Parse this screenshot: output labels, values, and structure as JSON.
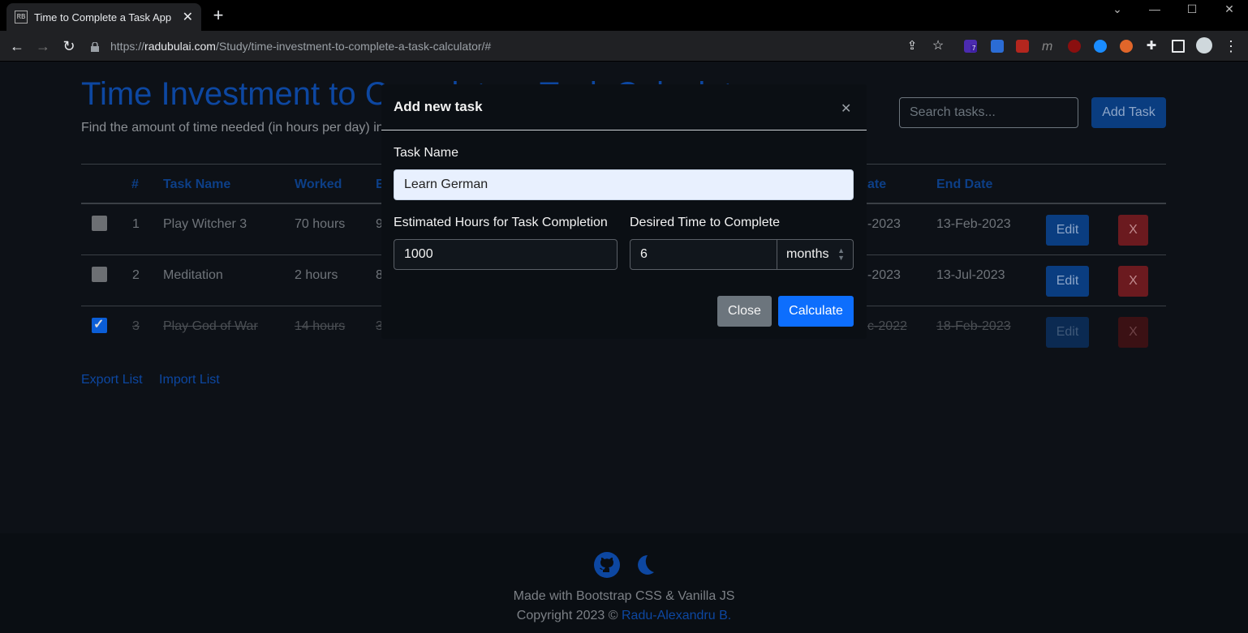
{
  "browser": {
    "tab_title": "Time to Complete a Task App",
    "favicon_text": "RB",
    "url_prefix": "https://",
    "url_host": "radubulai.com",
    "url_path": "/Study/time-investment-to-complete-a-task-calculator/#",
    "ext_badge": "7"
  },
  "page": {
    "title": "Time Investment to Complete a Task Calculator",
    "subtitle": "Find the amount of time needed (in hours per day) in order to complete a task",
    "search_placeholder": "Search tasks...",
    "add_task_label": "Add Task",
    "table": {
      "headers": [
        "#",
        "Task Name",
        "Worked",
        "E",
        "ate",
        "End Date"
      ],
      "rows": [
        {
          "num": "1",
          "name": "Play Witcher 3",
          "worked": "70 hours",
          "est": "9",
          "start": "-2023",
          "end": "13-Feb-2023",
          "done": false,
          "edit": "Edit",
          "del": "X"
        },
        {
          "num": "2",
          "name": "Meditation",
          "worked": "2 hours",
          "est": "8",
          "start": "-2023",
          "end": "13-Jul-2023",
          "done": false,
          "edit": "Edit",
          "del": "X"
        },
        {
          "num": "3",
          "name": "Play God of War",
          "worked": "14 hours",
          "est": "3",
          "start": "c-2022",
          "end": "18-Feb-2023",
          "done": true,
          "edit": "Edit",
          "del": "X"
        }
      ]
    },
    "export_label": "Export List",
    "import_label": "Import List"
  },
  "footer": {
    "made_with": "Made with Bootstrap CSS & Vanilla JS",
    "copyright": "Copyright 2023 ©",
    "author": "Radu-Alexandru B."
  },
  "modal": {
    "title": "Add new task",
    "task_name_label": "Task Name",
    "task_name_value": "Learn German",
    "hours_label": "Estimated Hours for Task Completion",
    "hours_value": "1000",
    "desired_label": "Desired Time to Complete",
    "desired_value": "6",
    "unit_value": "months",
    "close_label": "Close",
    "calculate_label": "Calculate"
  },
  "colors": {
    "primary": "#0d6efd",
    "danger": "#6b1a1f",
    "background": "#0d1117"
  }
}
